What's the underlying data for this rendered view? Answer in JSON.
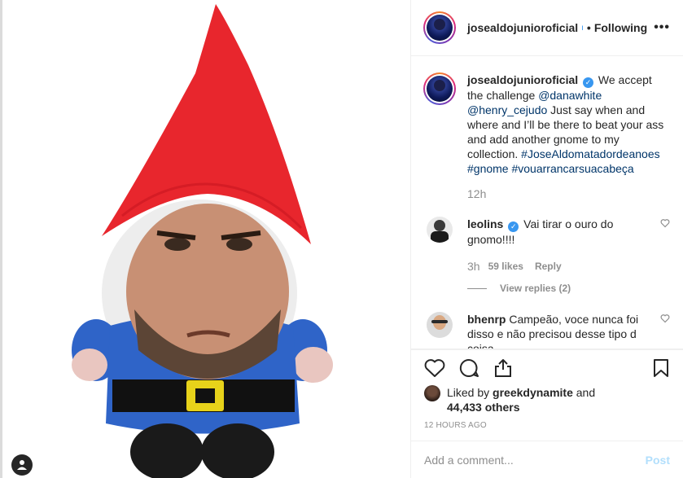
{
  "header": {
    "username": "josealdojunioroficial",
    "separator": "•",
    "follow_state": "Following",
    "more": "•••"
  },
  "caption": {
    "username": "josealdojunioroficial",
    "text_1": " We accept the challenge ",
    "mention_1": "@danawhite",
    "mention_2": "@henry_cejudo",
    "text_2": " Just say when and where and I’ll be there to beat your ass and add another gnome to my collection. ",
    "hashtag_1": "#JoseAldomatadordeanoes",
    "hashtag_2": "#gnome",
    "hashtag_3": "#vouarrancarsuacabeça",
    "time": "12h"
  },
  "comments": [
    {
      "username": "leolins",
      "verified": true,
      "text": " Vai tirar o ouro do gnomo!!!!",
      "time": "3h",
      "likes": "59 likes",
      "reply": "Reply",
      "view_replies": "View replies (2)"
    },
    {
      "username": "bhenrp",
      "verified": false,
      "text": " Campeão, voce nunca foi disso e não precisou desse tipo d coisa."
    }
  ],
  "likes": {
    "prefix": "Liked by ",
    "user": "greekdynamite",
    "middle": " and",
    "others": "44,433 others"
  },
  "posted_ago": "12 HOURS AGO",
  "add_comment": {
    "placeholder": "Add a comment...",
    "post_label": "Post"
  },
  "icons": {
    "like": "heart-icon",
    "comment": "comment-icon",
    "share": "share-icon",
    "save": "bookmark-icon",
    "tag": "user-tag-icon"
  },
  "colors": {
    "verified": "#3897f0",
    "link": "#003569",
    "post_button_disabled": "#b2dffc",
    "gnome_hat": "#e8262d",
    "gnome_body": "#2f64c8"
  }
}
